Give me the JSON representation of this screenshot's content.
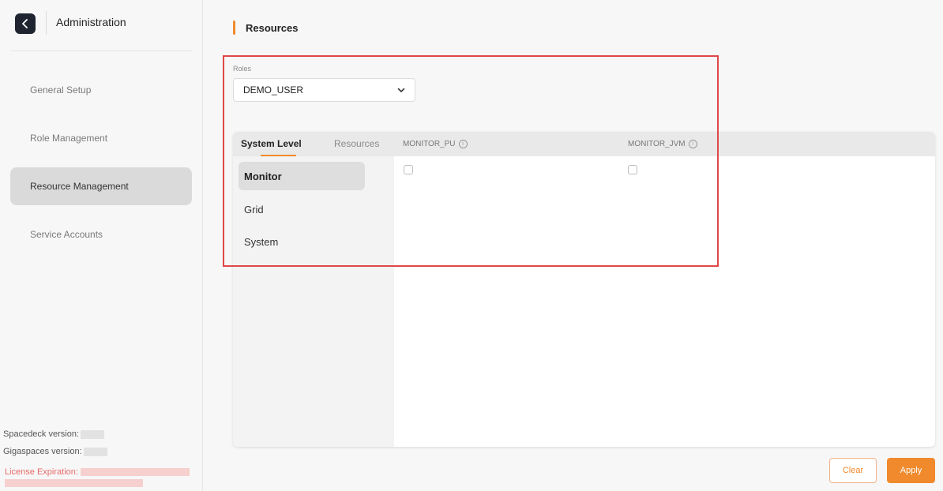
{
  "header": {
    "title": "Administration"
  },
  "sidebar": {
    "items": [
      {
        "label": "General Setup"
      },
      {
        "label": "Role Management"
      },
      {
        "label": "Resource Management",
        "active": true
      },
      {
        "label": "Service Accounts"
      }
    ],
    "spacedeck_version_label": "Spacedeck version:",
    "gigaspaces_version_label": "Gigaspaces version:",
    "license_label": "License Expiration:"
  },
  "main": {
    "title": "Resources",
    "roles": {
      "label": "Roles",
      "selected": "DEMO_USER"
    },
    "tabs": [
      {
        "label": "System Level",
        "active": true
      },
      {
        "label": "Resources",
        "active": false
      }
    ],
    "categories": [
      {
        "label": "Monitor",
        "active": true
      },
      {
        "label": "Grid",
        "active": false
      },
      {
        "label": "System",
        "active": false
      }
    ],
    "columns": [
      {
        "label": "MONITOR_PU",
        "checked": false
      },
      {
        "label": "MONITOR_JVM",
        "checked": false
      }
    ],
    "info_glyph": "i"
  },
  "actions": {
    "clear_label": "Clear",
    "apply_label": "Apply"
  },
  "colors": {
    "accent": "#f08a2c",
    "highlight": "#e04848",
    "dark": "#1f2530"
  }
}
